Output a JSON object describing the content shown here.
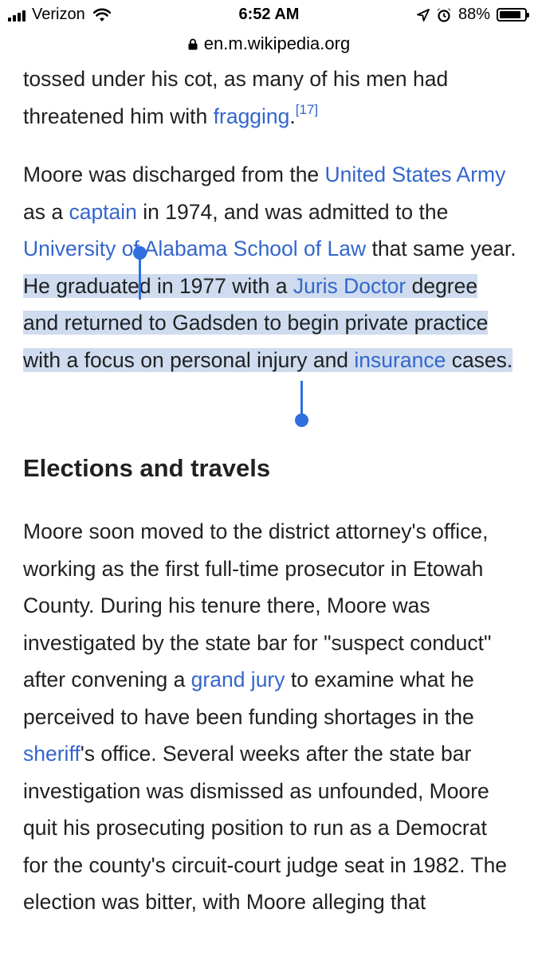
{
  "status_bar": {
    "carrier": "Verizon",
    "time": "6:52 AM",
    "battery_percent": "88%",
    "battery_level": 0.88,
    "icons": [
      "signal-icon",
      "wifi-icon",
      "location-icon",
      "alarm-icon",
      "battery-icon"
    ]
  },
  "url_bar": {
    "domain": "en.m.wikipedia.org",
    "icon": "lock-icon"
  },
  "article": {
    "p1": {
      "t1": "tossed under his cot, as many of his men had threatened him with ",
      "link1": "fragging",
      "t2": ".",
      "ref": "[17]"
    },
    "p2": {
      "t1": "Moore was discharged from the ",
      "link1": "United States Army",
      "t2": " as a ",
      "link2": "captain",
      "t3": " in 1974, and was admitted to the ",
      "link3": "University of Alabama School of Law",
      "t4": " that same year. ",
      "sel_t1": "He graduated in 1977 with a ",
      "sel_link1": "Juris Doctor",
      "sel_t2": " degree and returned to Gadsden to begin private practice with a focus on personal injury and ",
      "sel_link2": "insurance",
      "sel_t3": " cases."
    },
    "heading": "Elections and travels",
    "p3": {
      "t1": "Moore soon moved to the district attorney's office, working as the first full-time prosecutor in Etowah County. During his tenure there, Moore was investigated by the state bar for \"suspect conduct\" after convening a ",
      "link1": "grand jury",
      "t2": " to examine what he perceived to have been funding shortages in the ",
      "link2": "sheriff",
      "t3": "'s office. Several weeks after the state bar investigation was dismissed as unfounded, Moore quit his prosecuting position to run as a Democrat for the county's circuit-court judge seat in 1982. The election was bitter, with Moore alleging that"
    }
  },
  "colors": {
    "link": "#3366cc",
    "selection": "#cfdcef",
    "selection_handle": "#2f6fde",
    "text": "#202122"
  }
}
